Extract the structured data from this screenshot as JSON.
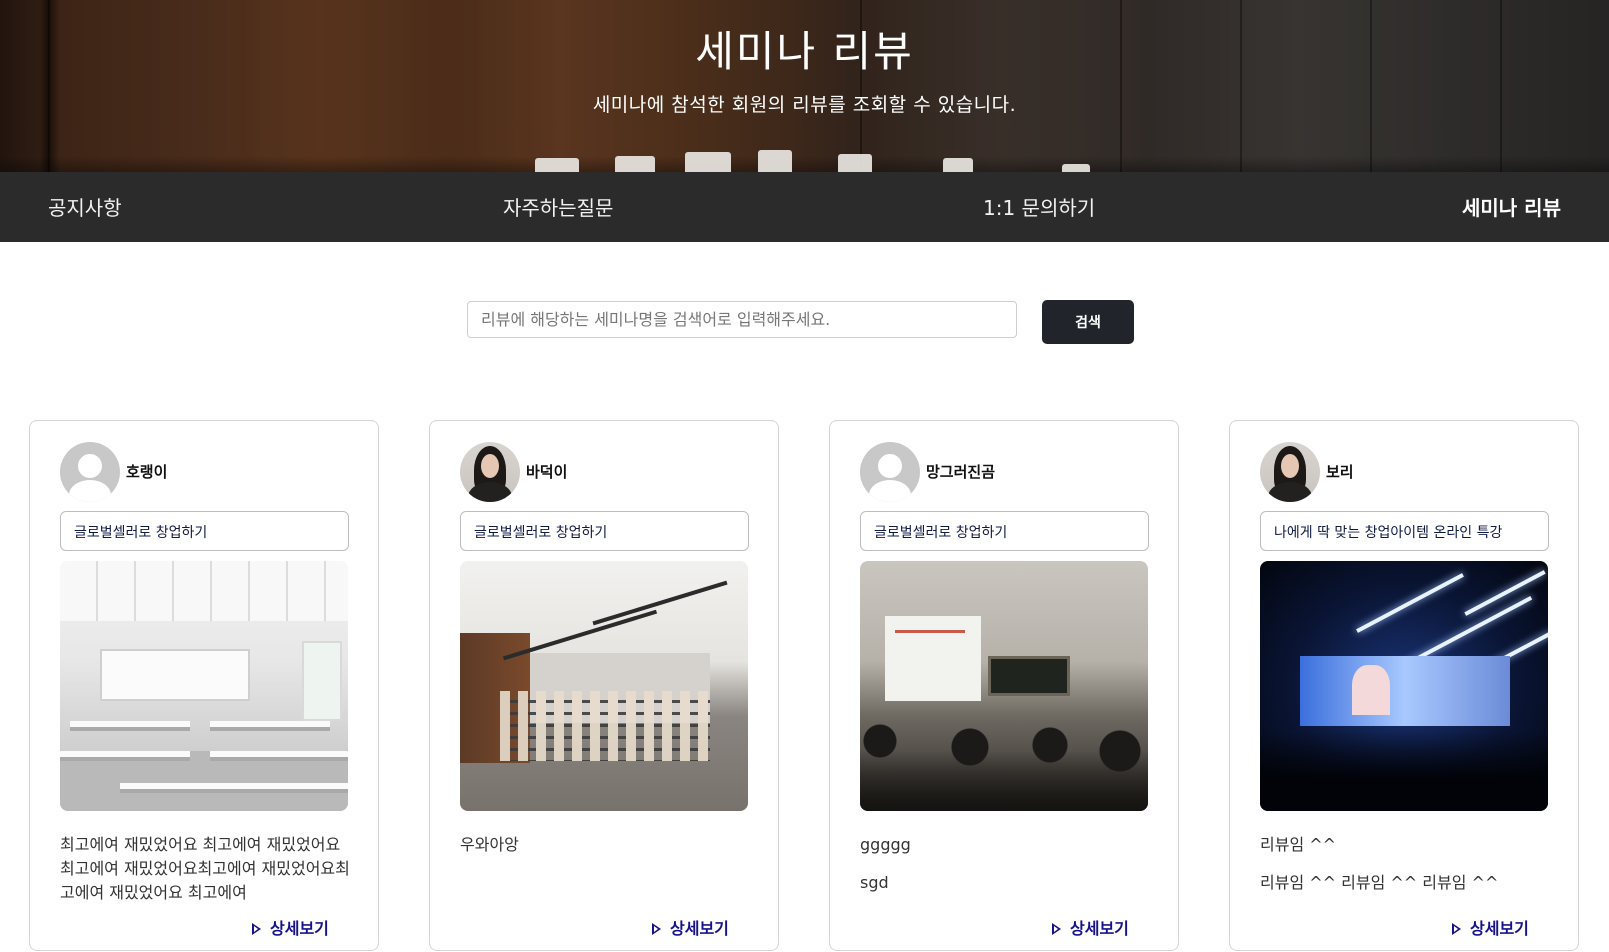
{
  "hero": {
    "title": "세미나 리뷰",
    "subtitle": "세미나에 참석한 회원의 리뷰를 조회할 수 있습니다."
  },
  "nav": {
    "items": [
      "공지사항",
      "자주하는질문",
      "1:1 문의하기",
      "세미나 리뷰"
    ],
    "active_index": 3
  },
  "search": {
    "placeholder": "리뷰에 해당하는 세미나명을 검색어로 입력해주세요.",
    "value": "",
    "button_label": "검색"
  },
  "cards": [
    {
      "username": "호랭이",
      "avatar": "default-avatar-icon",
      "seminar": "글로벌셀러로 창업하기",
      "review": [
        "최고에여 재밌었어요 최고에여 재밌었어요최고에여 재밌었어요최고에여 재밌었어요최고에여 재밌었어요 최고에여"
      ],
      "detail_label": "상세보기"
    },
    {
      "username": "바덕이",
      "avatar": "profile-photo",
      "seminar": "글로벌셀러로 창업하기",
      "review": [
        "우와아앙"
      ],
      "detail_label": "상세보기"
    },
    {
      "username": "망그러진곰",
      "avatar": "default-avatar-icon",
      "seminar": "글로벌셀러로 창업하기",
      "review": [
        "ggggg",
        "sgd"
      ],
      "detail_label": "상세보기"
    },
    {
      "username": "보리",
      "avatar": "profile-photo",
      "seminar": "나에게 딱 맞는 창업아이템 온라인 특강",
      "review": [
        "리뷰임 ^^",
        "리뷰임 ^^ 리뷰임 ^^ 리뷰임 ^^"
      ],
      "detail_label": "상세보기"
    }
  ],
  "colors": {
    "nav_background": "#2b2b2b",
    "search_button": "#21252b",
    "detail_link": "#16128a",
    "seminar_text": "#0f1b45"
  }
}
